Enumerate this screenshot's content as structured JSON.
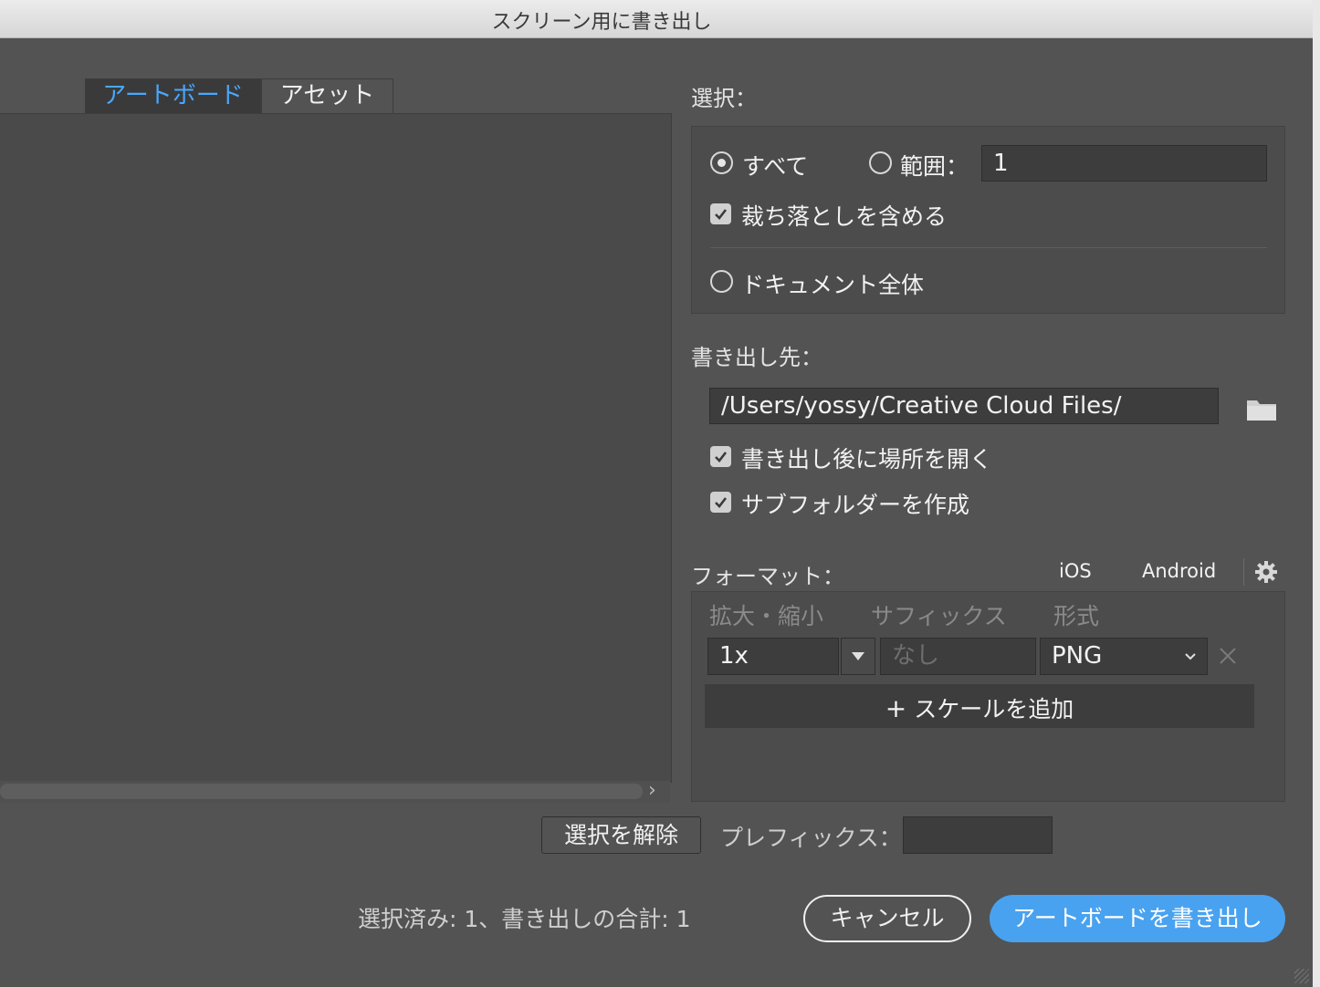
{
  "window": {
    "title": "スクリーン用に書き出し"
  },
  "tabs": [
    {
      "label": "アートボード",
      "active": true
    },
    {
      "label": "アセット",
      "active": false
    }
  ],
  "selection": {
    "label": "選択：",
    "all_label": "すべて",
    "all_selected": true,
    "range_label": "範囲：",
    "range_value": "1",
    "include_bleed_label": "裁ち落としを含める",
    "include_bleed_checked": true,
    "whole_document_label": "ドキュメント全体"
  },
  "export_to": {
    "label": "書き出し先：",
    "path": "/Users/yossy/Creative Cloud Files/",
    "open_after_label": "書き出し後に場所を開く",
    "open_after_checked": true,
    "subfolders_label": "サブフォルダーを作成",
    "subfolders_checked": true
  },
  "formats": {
    "label": "フォーマット：",
    "preset_ios": "iOS",
    "preset_android": "Android",
    "col_scale": "拡大・縮小",
    "col_suffix": "サフィックス",
    "col_format": "形式",
    "row": {
      "scale": "1x",
      "suffix_placeholder": "なし",
      "format": "PNG"
    },
    "add_scale_label": "スケールを追加"
  },
  "bottom": {
    "deselect_label": "選択を解除",
    "prefix_label": "プレフィックス：",
    "prefix_value": "",
    "status": "選択済み: 1、書き出しの合計: 1",
    "cancel_label": "キャンセル",
    "export_label": "アートボードを書き出し"
  },
  "colors": {
    "accent": "#48a2f0",
    "tab_active_text": "#48a8ff",
    "background": "#535353"
  },
  "icons": [
    "folder-icon",
    "gear-icon",
    "dropdown-arrow-icon",
    "chevron-down-icon",
    "close-icon",
    "plus-icon",
    "chevron-right-icon"
  ]
}
